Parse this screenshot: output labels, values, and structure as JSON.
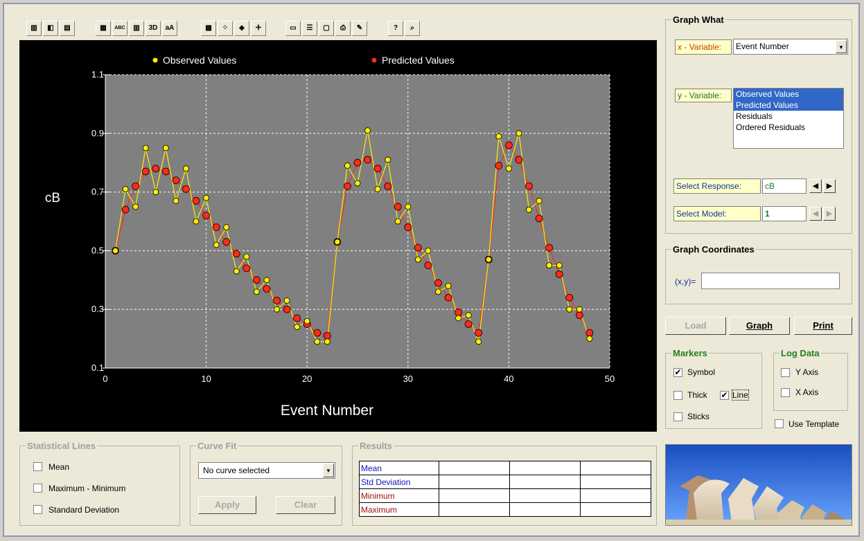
{
  "toolbar": {
    "buttons": [
      {
        "name": "bar-chart-icon",
        "glyph": "▥"
      },
      {
        "name": "area-chart-icon",
        "glyph": "◧"
      },
      {
        "name": "gantt-chart-icon",
        "glyph": "▤"
      },
      {
        "name": "data-grid-icon",
        "glyph": "▦"
      },
      {
        "name": "text-abc-icon",
        "glyph": "ABC"
      },
      {
        "name": "grid-lines-icon",
        "glyph": "▥"
      },
      {
        "name": "three-d-icon",
        "glyph": "3D"
      },
      {
        "name": "font-icon",
        "glyph": "aA"
      },
      {
        "name": "pattern-icon",
        "glyph": "▩"
      },
      {
        "name": "scatter-icon",
        "glyph": "⁘"
      },
      {
        "name": "marker-icon",
        "glyph": "◈"
      },
      {
        "name": "crosshair-icon",
        "glyph": "✛"
      },
      {
        "name": "legend-icon",
        "glyph": "▭"
      },
      {
        "name": "list-icon",
        "glyph": "☰"
      },
      {
        "name": "label-icon",
        "glyph": "▢"
      },
      {
        "name": "print-preview-icon",
        "glyph": "⎙"
      },
      {
        "name": "pen-icon",
        "glyph": "✎"
      },
      {
        "name": "help-icon",
        "glyph": "?"
      },
      {
        "name": "zoom-icon",
        "glyph": "⌕"
      }
    ]
  },
  "chart_data": {
    "type": "line",
    "xlabel": "Event Number",
    "ylabel": "cB",
    "xlim": [
      0,
      50
    ],
    "ylim": [
      0.1,
      1.1
    ],
    "xticks": [
      0,
      10,
      20,
      30,
      40,
      50
    ],
    "yticks": [
      0.1,
      0.3,
      0.5,
      0.7,
      0.9,
      1.1
    ],
    "grid": true,
    "legend_position": "top",
    "series": [
      {
        "name": "Observed Values",
        "color": "#ffee00",
        "x": [
          1,
          2,
          3,
          4,
          5,
          6,
          7,
          8,
          9,
          10,
          11,
          12,
          13,
          14,
          15,
          16,
          17,
          18,
          19,
          20,
          21,
          22,
          23,
          24,
          25,
          26,
          27,
          28,
          29,
          30,
          31,
          32,
          33,
          34,
          35,
          36,
          37,
          38,
          39,
          40,
          41,
          42,
          43,
          44,
          45,
          46,
          47,
          48
        ],
        "y": [
          0.5,
          0.71,
          0.65,
          0.85,
          0.7,
          0.85,
          0.67,
          0.78,
          0.6,
          0.68,
          0.52,
          0.58,
          0.43,
          0.48,
          0.36,
          0.4,
          0.3,
          0.33,
          0.24,
          0.26,
          0.19,
          0.19,
          0.53,
          0.79,
          0.73,
          0.91,
          0.71,
          0.81,
          0.6,
          0.65,
          0.47,
          0.5,
          0.36,
          0.38,
          0.27,
          0.28,
          0.19,
          0.47,
          0.89,
          0.78,
          0.9,
          0.64,
          0.67,
          0.45,
          0.45,
          0.3,
          0.3,
          0.2
        ]
      },
      {
        "name": "Predicted Values",
        "color": "#ff2a1a",
        "x": [
          1,
          2,
          3,
          4,
          5,
          6,
          7,
          8,
          9,
          10,
          11,
          12,
          13,
          14,
          15,
          16,
          17,
          18,
          19,
          20,
          21,
          22,
          23,
          24,
          25,
          26,
          27,
          28,
          29,
          30,
          31,
          32,
          33,
          34,
          35,
          36,
          37,
          38,
          39,
          40,
          41,
          42,
          43,
          44,
          45,
          46,
          47,
          48
        ],
        "y": [
          0.5,
          0.64,
          0.72,
          0.77,
          0.78,
          0.77,
          0.74,
          0.71,
          0.67,
          0.62,
          0.58,
          0.53,
          0.49,
          0.44,
          0.4,
          0.37,
          0.33,
          0.3,
          0.27,
          0.25,
          0.22,
          0.21,
          0.53,
          0.72,
          0.8,
          0.81,
          0.78,
          0.72,
          0.65,
          0.58,
          0.51,
          0.45,
          0.39,
          0.34,
          0.29,
          0.25,
          0.22,
          0.47,
          0.79,
          0.86,
          0.81,
          0.72,
          0.61,
          0.51,
          0.42,
          0.34,
          0.28,
          0.22
        ]
      }
    ]
  },
  "graph_what": {
    "title": "Graph What",
    "x_variable_label": "x - Variable:",
    "x_variable_value": "Event Number",
    "y_variable_label": "y - Variable:",
    "y_options": [
      {
        "label": "Observed Values",
        "selected": true
      },
      {
        "label": "Predicted Values",
        "selected": true
      },
      {
        "label": "Residuals",
        "selected": false
      },
      {
        "label": "Ordered Residuals",
        "selected": false
      }
    ],
    "select_response_label": "Select Response:",
    "select_response_value": "cB",
    "select_model_label": "Select Model:",
    "select_model_value": "1"
  },
  "graph_coordinates": {
    "title": "Graph Coordinates",
    "label": "(x,y)=",
    "value": ""
  },
  "buttons": {
    "load": "Load",
    "graph": "Graph",
    "print": "Print"
  },
  "markers": {
    "title": "Markers",
    "symbol": {
      "label": "Symbol",
      "checked": true
    },
    "thick": {
      "label": "Thick",
      "checked": false
    },
    "line": {
      "label": "Line",
      "checked": true
    },
    "sticks": {
      "label": "Sticks",
      "checked": false
    }
  },
  "log_data": {
    "title": "Log Data",
    "y_axis": {
      "label": "Y Axis",
      "checked": false
    },
    "x_axis": {
      "label": "X Axis",
      "checked": false
    }
  },
  "use_template": {
    "label": "Use Template",
    "checked": false
  },
  "statistical_lines": {
    "title": "Statistical Lines",
    "mean": "Mean",
    "max_min": "Maximum - Minimum",
    "std_dev": "Standard Deviation"
  },
  "curve_fit": {
    "title": "Curve Fit",
    "selected": "No curve selected",
    "apply": "Apply",
    "clear": "Clear"
  },
  "results": {
    "title": "Results",
    "rows": [
      {
        "label": "Mean",
        "color": "#1010c0"
      },
      {
        "label": "Std Deviation",
        "color": "#1010c0"
      },
      {
        "label": "Minimum",
        "color": "#a01010"
      },
      {
        "label": "Maximum",
        "color": "#a01010"
      }
    ]
  }
}
